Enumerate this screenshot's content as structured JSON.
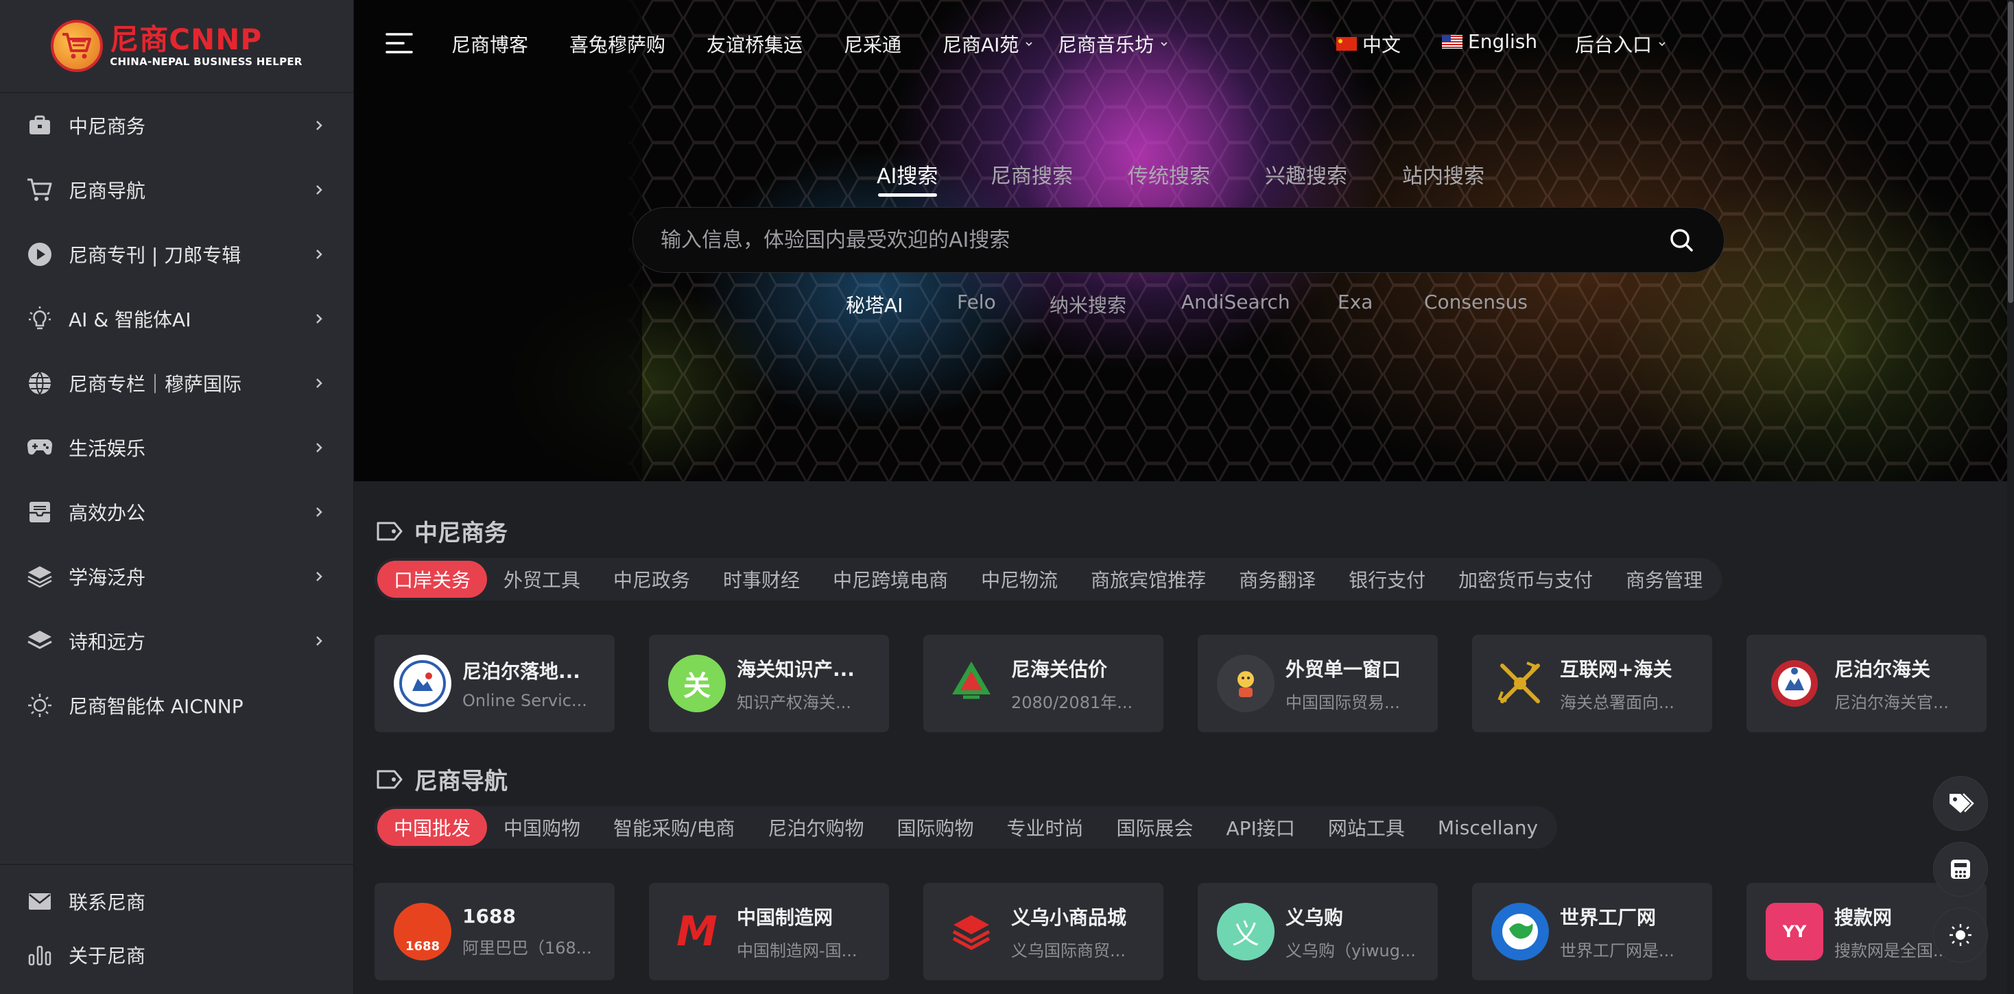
{
  "logo": {
    "main": "尼商CNNP",
    "sub": "CHINA-NEPAL BUSINESS HELPER"
  },
  "sidebar": {
    "items": [
      {
        "label": "中尼商务",
        "icon": "briefcase-icon"
      },
      {
        "label": "尼商导航",
        "icon": "cart-icon"
      },
      {
        "label": "尼商专刊 | 刀郎专辑",
        "icon": "play-icon"
      },
      {
        "label": "AI & 智能体AI",
        "icon": "lightbulb-icon"
      },
      {
        "label": "尼商专栏｜穆萨国际",
        "icon": "globe-icon"
      },
      {
        "label": "生活娱乐",
        "icon": "gamepad-icon"
      },
      {
        "label": "高效办公",
        "icon": "inbox-icon"
      },
      {
        "label": "学海泛舟",
        "icon": "layers-icon"
      },
      {
        "label": "诗和远方",
        "icon": "stack-icon"
      },
      {
        "label": "尼商智能体 AICNNP",
        "icon": "sun-icon"
      }
    ],
    "bottom": [
      {
        "label": "联系尼商",
        "icon": "mail-icon"
      },
      {
        "label": "关于尼商",
        "icon": "bar-chart-icon"
      }
    ]
  },
  "topnav": {
    "links": [
      "尼商博客",
      "喜兔穆萨购",
      "友谊桥集运",
      "尼采通",
      "尼商AI苑",
      "尼商音乐坊"
    ],
    "lang_zh": "中文",
    "lang_en": "English",
    "admin": "后台入口"
  },
  "search": {
    "tabs": [
      "AI搜索",
      "尼商搜索",
      "传统搜索",
      "兴趣搜索",
      "站内搜索"
    ],
    "placeholder": "输入信息，体验国内最受欢迎的AI搜索",
    "engines": [
      "秘塔AI",
      "Felo",
      "纳米搜索",
      "AndiSearch",
      "Exa",
      "Consensus"
    ]
  },
  "sections": [
    {
      "title": "中尼商务",
      "tabs": [
        "口岸关务",
        "外贸工具",
        "中尼政务",
        "时事财经",
        "中尼跨境电商",
        "中尼物流",
        "商旅宾馆推荐",
        "商务翻译",
        "银行支付",
        "加密货币与支付",
        "商务管理"
      ],
      "cards": [
        {
          "title": "尼泊尔落地...",
          "desc": "Online Servic...",
          "icon_char": ""
        },
        {
          "title": "海关知识产...",
          "desc": "知识产权海关...",
          "icon_char": "关"
        },
        {
          "title": "尼海关估价",
          "desc": "2080/2081年...",
          "icon_char": ""
        },
        {
          "title": "外贸单一窗口",
          "desc": "中国国际贸易...",
          "icon_char": ""
        },
        {
          "title": "互联网+海关",
          "desc": "海关总署面向...",
          "icon_char": ""
        },
        {
          "title": "尼泊尔海关",
          "desc": "尼泊尔海关官...",
          "icon_char": ""
        }
      ]
    },
    {
      "title": "尼商导航",
      "tabs": [
        "中国批发",
        "中国购物",
        "智能采购/电商",
        "尼泊尔购物",
        "国际购物",
        "专业时尚",
        "国际展会",
        "API接口",
        "网站工具",
        "Miscellany"
      ],
      "cards": [
        {
          "title": "1688",
          "desc": "阿里巴巴（168...",
          "icon_char": "1688"
        },
        {
          "title": "中国制造网",
          "desc": "中国制造网-国...",
          "icon_char": "M"
        },
        {
          "title": "义乌小商品城",
          "desc": "义乌国际商贸...",
          "icon_char": ""
        },
        {
          "title": "义乌购",
          "desc": "义乌购（yiwug...",
          "icon_char": "义"
        },
        {
          "title": "世界工厂网",
          "desc": "世界工厂网是...",
          "icon_char": ""
        },
        {
          "title": "搜款网",
          "desc": "搜款网是全国...",
          "icon_char": "YY"
        }
      ]
    }
  ],
  "colors": {
    "accent": "#e8424e",
    "sidebar_bg": "#2a2b30",
    "content_bg": "#1f2024"
  }
}
